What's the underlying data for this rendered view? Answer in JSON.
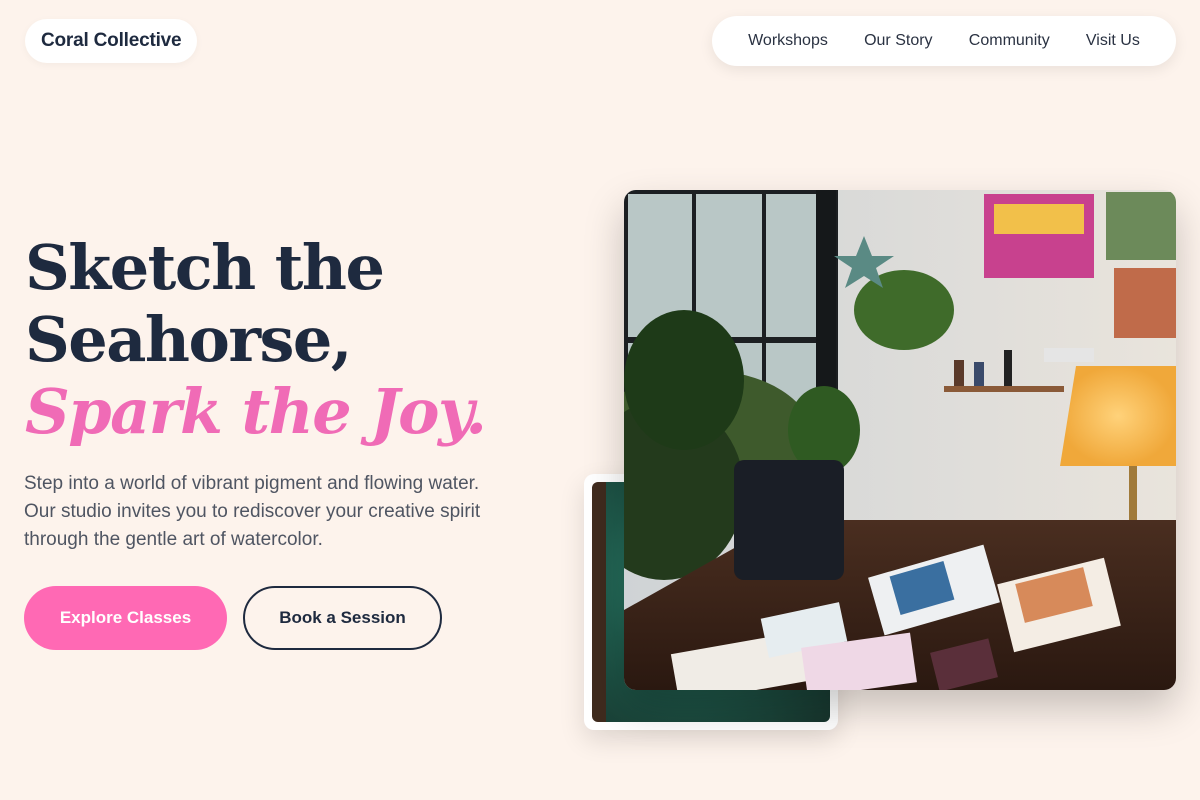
{
  "brand": {
    "name": "Coral Collective"
  },
  "nav": {
    "items": [
      {
        "label": "Workshops"
      },
      {
        "label": "Our Story"
      },
      {
        "label": "Community"
      },
      {
        "label": "Visit Us"
      }
    ]
  },
  "hero": {
    "headline_line1": "Sketch the",
    "headline_line2": "Seahorse,",
    "headline_accent": "Spark the Joy.",
    "description": "Step into a world of vibrant pigment and flowing water. Our studio invites you to rediscover your creative spirit through the gentle art of watercolor.",
    "primary_button": "Explore Classes",
    "secondary_button": "Book a Session"
  },
  "colors": {
    "background": "#fdf3ec",
    "navy": "#1e2a3f",
    "accent_pink": "#ff69b4"
  }
}
